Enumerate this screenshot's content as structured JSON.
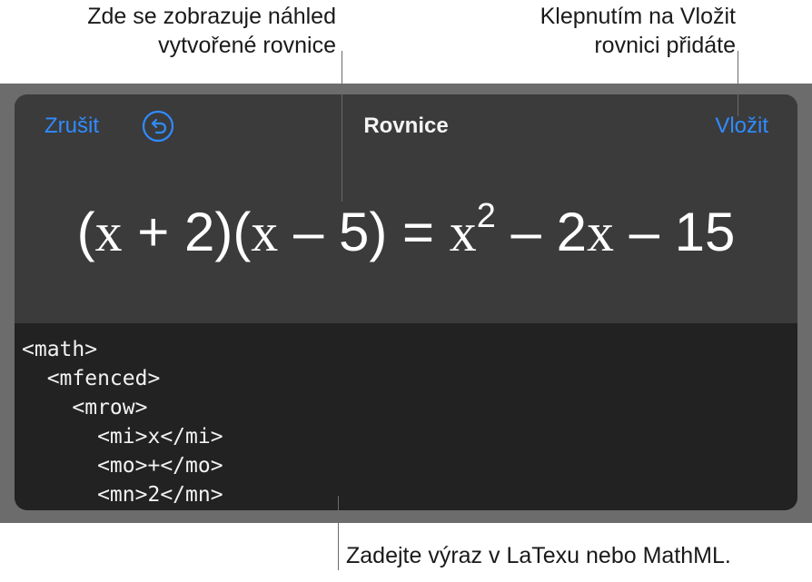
{
  "callouts": {
    "preview": [
      "Zde se zobrazuje náhled",
      "vytvořené rovnice"
    ],
    "insert": [
      "Klepnutím na Vložit",
      "rovnici přidáte"
    ],
    "input": "Zadejte výraz v LaTexu nebo MathML."
  },
  "dialog": {
    "cancel_label": "Zrušit",
    "title": "Rovnice",
    "insert_label": "Vložit",
    "undo_icon": "undo-arrow-icon",
    "accent_color": "#2f8cff"
  },
  "equation": {
    "open1": "(",
    "x1": "x",
    "plus2": " + 2)",
    "open2": "(",
    "x2": "x",
    "minus5": " – 5) = ",
    "x3": "x",
    "exp": "2",
    "minus2": " – 2",
    "x4": "x",
    "minus15": " – 15"
  },
  "code_lines": [
    "<math>",
    "  <mfenced>",
    "    <mrow>",
    "      <mi>x</mi>",
    "      <mo>+</mo>",
    "      <mn>2</mn>"
  ]
}
